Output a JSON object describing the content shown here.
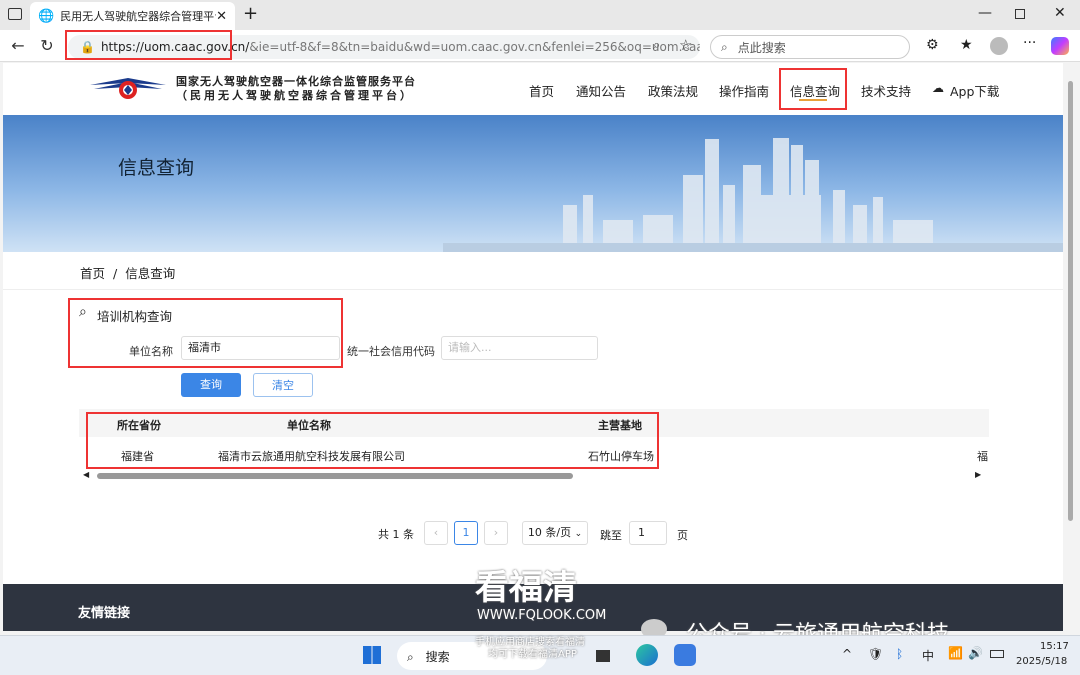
{
  "tab": {
    "title": "民用无人驾驶航空器综合管理平台"
  },
  "browser": {
    "url_host": "https://uom.caac.gov.cn/",
    "url_rest": "&ie=utf-8&f=8&tn=baidu&wd=uom.caac.gov.cn&fenlei=256&oq=uom.caac...",
    "search_placeholder": "点此搜索"
  },
  "site": {
    "title_line1": "国家无人驾驶航空器一体化综合监管服务平台",
    "title_line2": "（民用无人驾驶航空器综合管理平台）",
    "menu": [
      "首页",
      "通知公告",
      "政策法规",
      "操作指南",
      "信息查询",
      "技术支持",
      "App下载"
    ]
  },
  "banner": {
    "title": "信息查询"
  },
  "breadcrumb": {
    "home": "首页",
    "sep": "/",
    "current": "信息查询"
  },
  "query": {
    "section_title": "培训机构查询",
    "unit_label": "单位名称",
    "unit_value": "福清市",
    "credit_label": "统一社会信用代码",
    "credit_placeholder": "请输入...",
    "search_btn": "查询",
    "clear_btn": "清空"
  },
  "table": {
    "headers": [
      "所在省份",
      "单位名称",
      "主营基地"
    ],
    "rows": [
      [
        "福建省",
        "福清市云旅通用航空科技发展有限公司",
        "石竹山停车场",
        "福"
      ]
    ]
  },
  "pagination": {
    "total": "共 1 条",
    "page": "1",
    "page_size": "10 条/页",
    "goto_label": "跳至",
    "goto_value": "1",
    "page_suffix": "页"
  },
  "footer": {
    "title": "友情链接"
  },
  "watermark": {
    "big": "看福清",
    "site": "WWW.FQLOOK.COM",
    "wechat": "公众号 · 云旅通用航空科技",
    "sub1": "手机应用商店搜索看福清",
    "sub2": "均可下载看福清APP"
  },
  "taskbar": {
    "search": "搜索",
    "lang": "中",
    "time": "15:17",
    "date": "2025/5/18"
  }
}
